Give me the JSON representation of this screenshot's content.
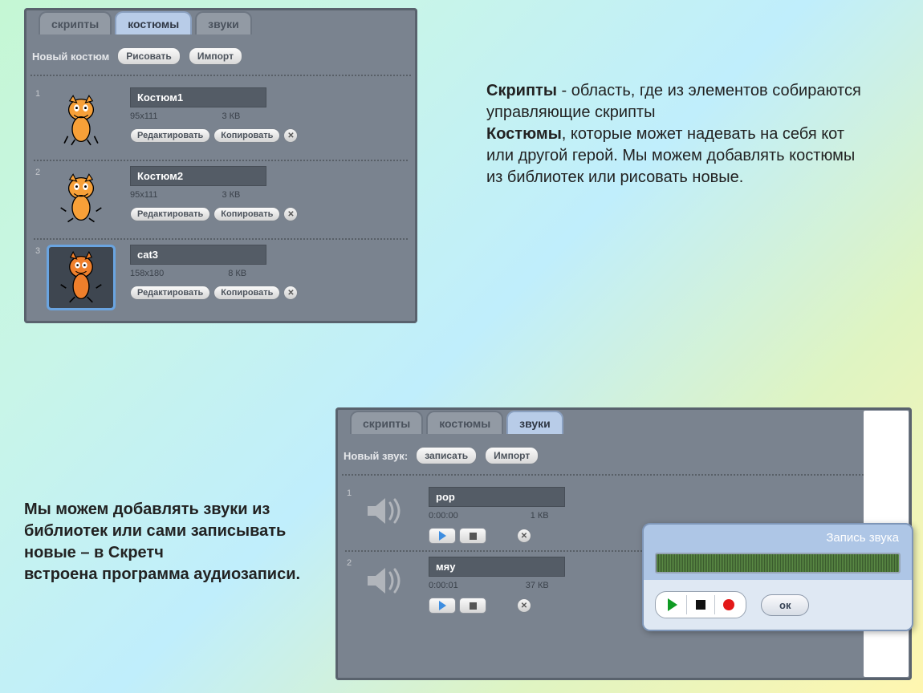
{
  "costumesPanel": {
    "tabs": {
      "scripts": "скрипты",
      "costumes": "костюмы",
      "sounds": "звуки"
    },
    "newLabel": "Новый костюм",
    "drawBtn": "Рисовать",
    "importBtn": "Импорт",
    "editBtn": "Редактировать",
    "copyBtn": "Копировать",
    "items": [
      {
        "num": "1",
        "name": "Костюм1",
        "dim": "95x111",
        "size": "3 КВ"
      },
      {
        "num": "2",
        "name": "Костюм2",
        "dim": "95x111",
        "size": "3 КВ"
      },
      {
        "num": "3",
        "name": "cat3",
        "dim": "158x180",
        "size": "8 КВ"
      }
    ]
  },
  "soundsPanel": {
    "tabs": {
      "scripts": "скрипты",
      "costumes": "костюмы",
      "sounds": "звуки"
    },
    "newLabel": "Новый звук:",
    "recordBtn": "записать",
    "importBtn": "Импорт",
    "items": [
      {
        "num": "1",
        "name": "pop",
        "time": "0:00:00",
        "size": "1 КВ"
      },
      {
        "num": "2",
        "name": "мяу",
        "time": "0:00:01",
        "size": "37 КВ"
      }
    ]
  },
  "recorder": {
    "title": "Запись звука",
    "ok": "ок"
  },
  "text1": {
    "b1": "Скрипты",
    "t1": " - область, где из элементов собираются управляющие скрипты",
    "b2": "Костюмы",
    "t2": ", которые может надевать на себя кот или другой герой. Мы можем добавлять костюмы из библиотек или рисовать новые."
  },
  "text2": {
    "l1": "Мы можем добавлять звуки из библиотек или сами записывать новые – в Скретч",
    "l2": "встроена программа аудиозаписи."
  }
}
